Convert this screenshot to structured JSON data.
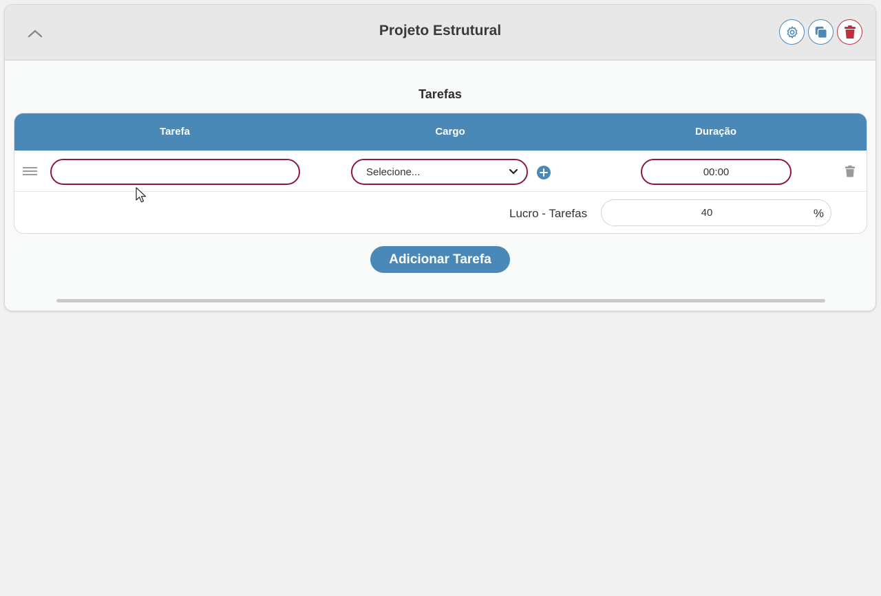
{
  "header": {
    "title": "Projeto Estrutural",
    "icons": {
      "collapse": "chevron-up-icon",
      "settings": "settings-gear-icon",
      "duplicate": "copy-icon",
      "delete": "trash-icon"
    },
    "colors": {
      "accent": "#4a89b7",
      "danger": "#c0303e"
    }
  },
  "section": {
    "title": "Tarefas"
  },
  "table": {
    "columns": [
      "Tarefa",
      "Cargo",
      "Duração"
    ],
    "rows": [
      {
        "tarefa_value": "",
        "cargo_selected": "Selecione...",
        "duracao_value": "00:00"
      }
    ],
    "input_border_color": "#8c1a35"
  },
  "lucro": {
    "label": "Lucro - Tarefas",
    "value": "40",
    "unit": "%"
  },
  "actions": {
    "add_task": "Adicionar Tarefa"
  }
}
